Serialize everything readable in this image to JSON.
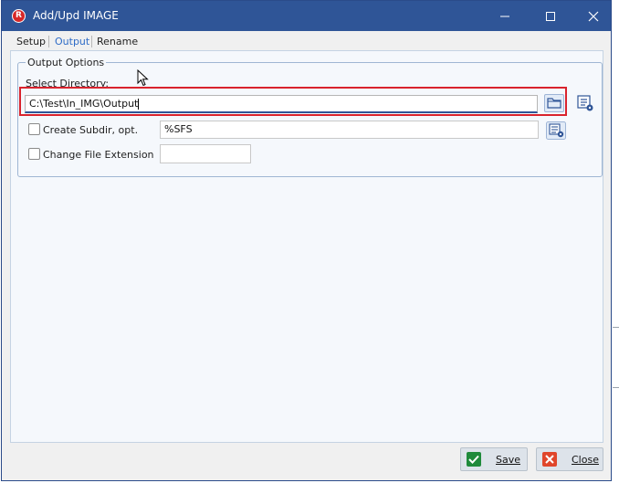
{
  "window": {
    "title": "Add/Upd IMAGE",
    "app_icon_letter": "R",
    "controls": {
      "minimize": "—",
      "maximize": "☐",
      "close": "✕"
    }
  },
  "tabs": [
    {
      "label": "Setup",
      "active": false
    },
    {
      "label": "Output",
      "active": true
    },
    {
      "label": "Rename",
      "active": false
    }
  ],
  "output_options": {
    "group_title": "Output Options",
    "select_directory_label": "Select Directory:",
    "directory_value": "C:\\Test\\In_IMG\\Output",
    "create_subdir": {
      "label": "Create Subdir, opt.",
      "checked": false,
      "value": "%SFS"
    },
    "change_ext": {
      "label": "Change File Extension",
      "checked": false,
      "value": ""
    }
  },
  "footer": {
    "save_label": "Save",
    "close_label": "Close"
  },
  "colors": {
    "titlebar": "#2f5597",
    "highlight": "#d9232d",
    "save_icon": "#1f8a3b",
    "close_icon": "#e0462b"
  },
  "icons": [
    "folder-icon",
    "list-settings-icon",
    "checkmark-icon",
    "x-icon",
    "mouse-cursor-icon"
  ]
}
